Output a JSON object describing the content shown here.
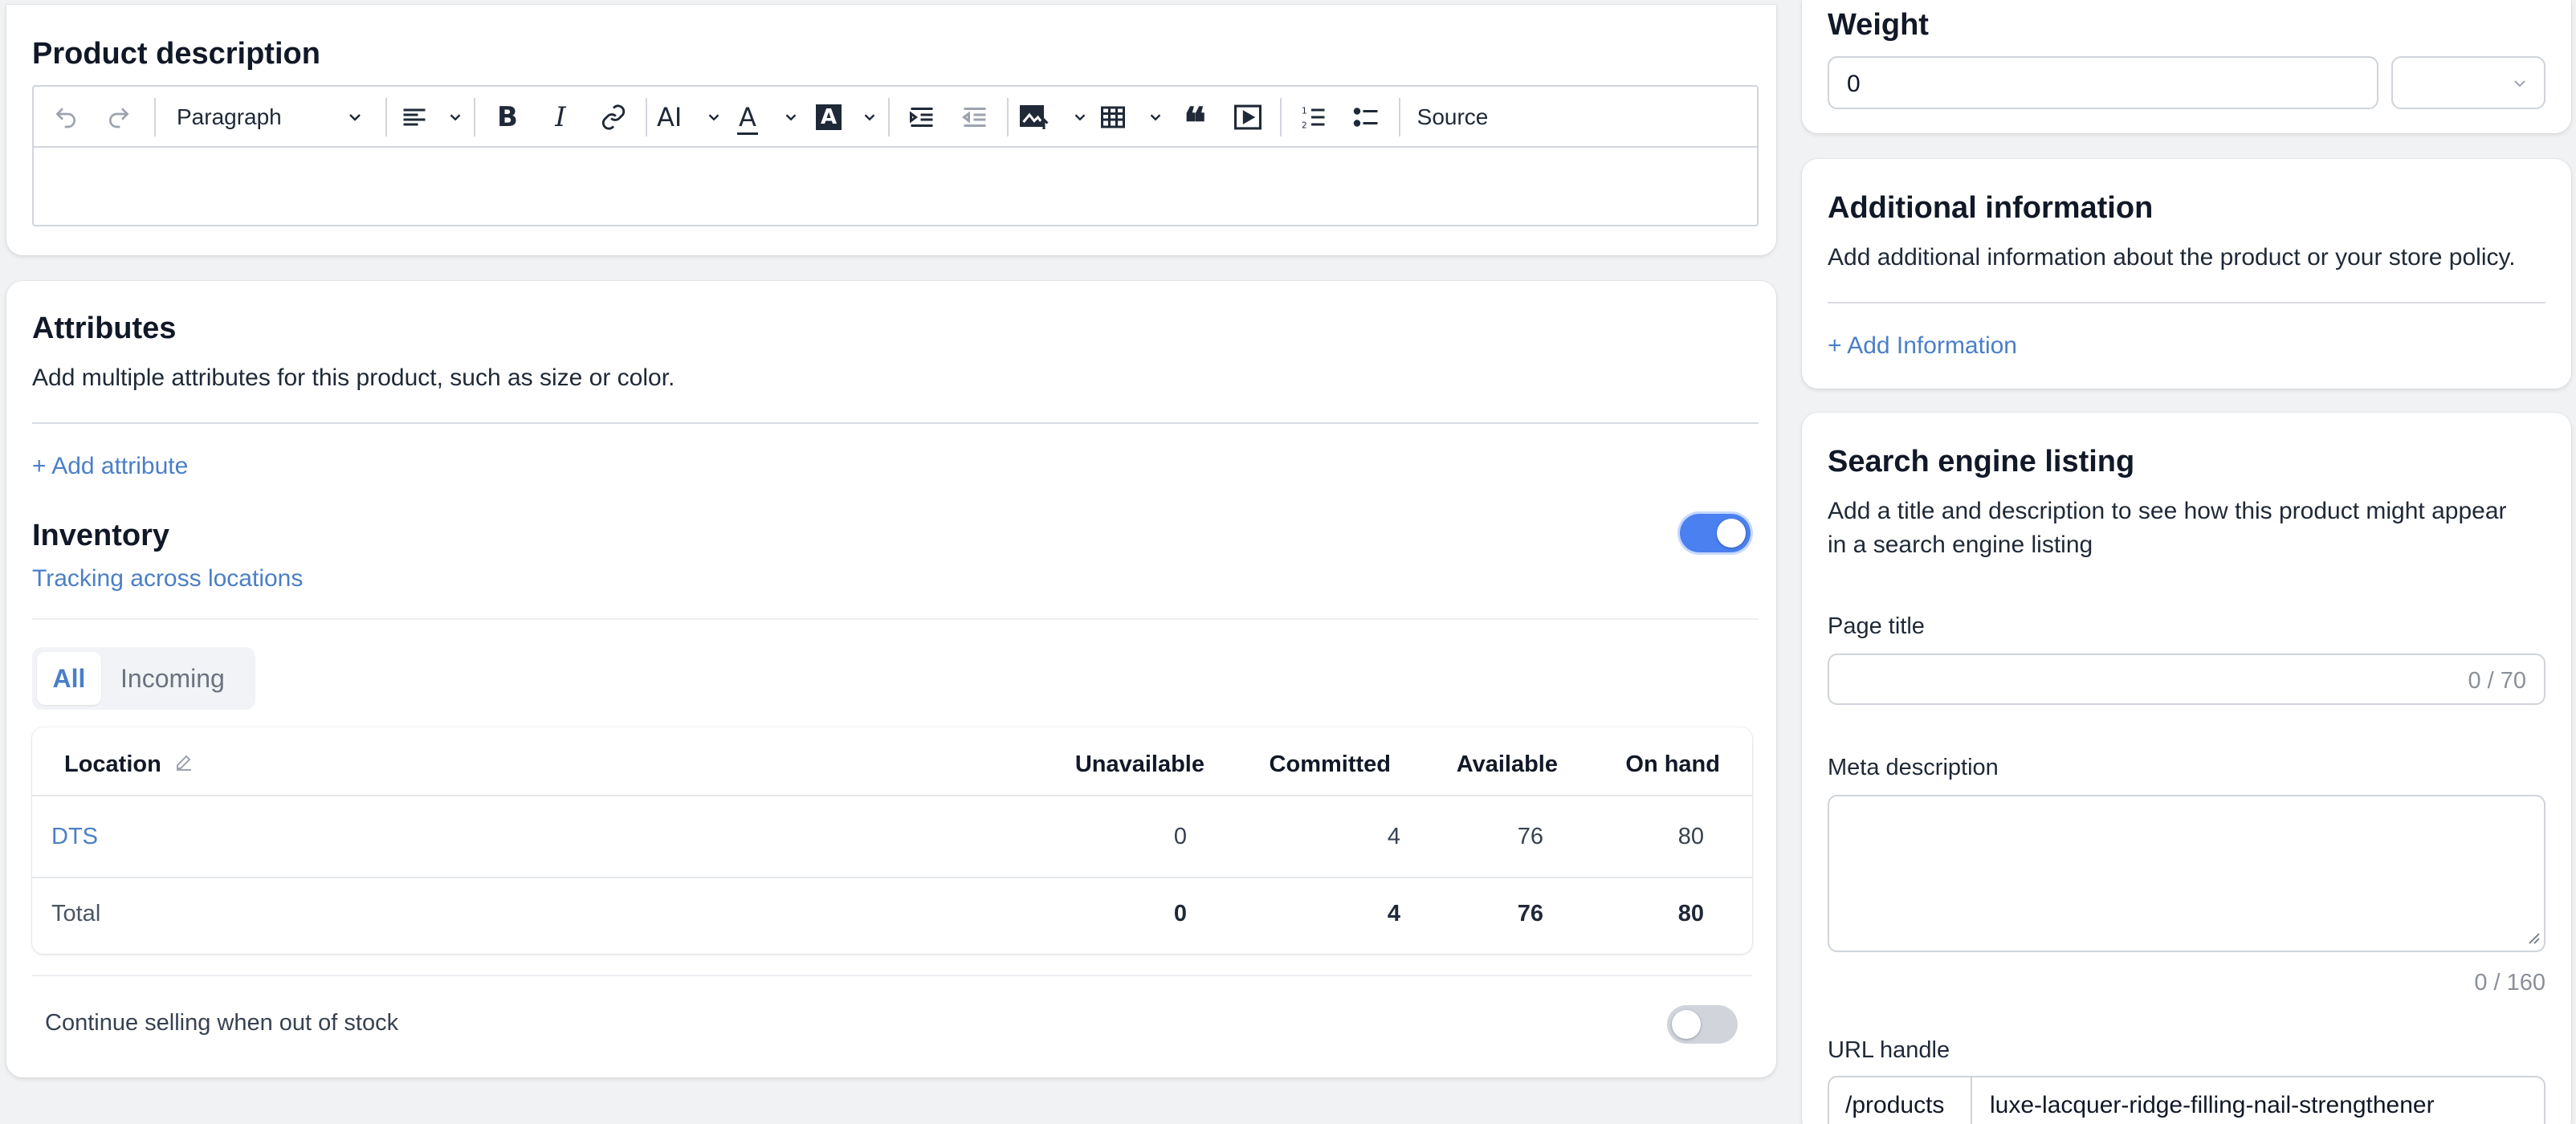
{
  "product_description": {
    "title": "Product description",
    "toolbar": {
      "paragraph_label": "Paragraph",
      "source_label": "Source"
    }
  },
  "attributes": {
    "title": "Attributes",
    "description": "Add multiple attributes for this product, such as size or color.",
    "add_label": "+ Add attribute"
  },
  "inventory": {
    "title": "Inventory",
    "subtitle": "Tracking across locations",
    "tracking_enabled": true,
    "tabs": [
      "All",
      "Incoming"
    ],
    "active_tab": "All",
    "columns": {
      "location": "Location",
      "unavailable": "Unavailable",
      "committed": "Committed",
      "available": "Available",
      "on_hand": "On hand"
    },
    "rows": [
      {
        "location": "DTS",
        "unavailable": "0",
        "committed": "4",
        "available": "76",
        "on_hand": "80"
      }
    ],
    "total": {
      "label": "Total",
      "unavailable": "0",
      "committed": "4",
      "available": "76",
      "on_hand": "80"
    },
    "continue_selling_label": "Continue selling when out of stock",
    "continue_selling_enabled": false
  },
  "weight": {
    "title": "Weight",
    "value": "0",
    "unit": ""
  },
  "additional_info": {
    "title": "Additional information",
    "description": "Add additional information about the product or your store policy.",
    "add_label": "+ Add Information"
  },
  "seo": {
    "title": "Search engine listing",
    "description_line1": "Add a title and description to see how this product might appear",
    "description_line2": "in a search engine listing",
    "page_title_label": "Page title",
    "page_title_value": "",
    "page_title_counter": "0 / 70",
    "meta_label": "Meta description",
    "meta_value": "",
    "meta_counter": "0 / 160",
    "url_label": "URL handle",
    "url_prefix": "/products",
    "url_value": "luxe-lacquer-ridge-filling-nail-strengthener"
  },
  "colors": {
    "accent": "#4a7fc8",
    "toggle_on": "#4a80f0",
    "toggle_off": "#d1d5db"
  }
}
